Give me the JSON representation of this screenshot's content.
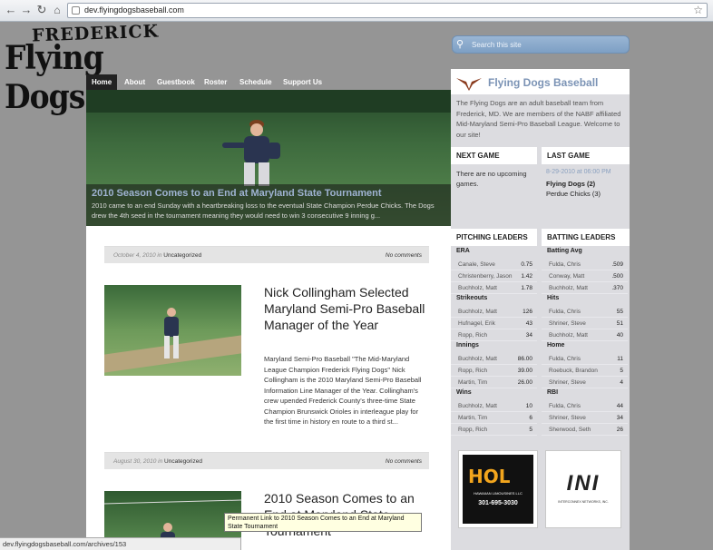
{
  "browser": {
    "url": "dev.flyingdogsbaseball.com"
  },
  "logo": {
    "line1": "FREDERICK",
    "line2": "Flying Dogs"
  },
  "nav": [
    "Home",
    "About",
    "Guestbook",
    "Roster",
    "Schedule",
    "Support Us"
  ],
  "hero": {
    "title": "2010 Season Comes to an End at Maryland State Tournament",
    "excerpt": "2010 came to an end Sunday with a heartbreaking loss to the eventual State Champion Perdue Chicks. The Dogs drew the 4th seed in the tournament meaning they would need to win 3 consecutive 9 inning g..."
  },
  "posts": [
    {
      "date": "October 4, 2010 in",
      "category": "Uncategorized",
      "comments": "No comments",
      "title": "Nick Collingham Selected Maryland Semi-Pro Baseball Manager of the Year",
      "excerpt": "Maryland Semi-Pro Baseball \"The Mid-Maryland League Champion Frederick Flying Dogs\" Nick Collingham is the 2010 Maryland Semi-Pro Baseball Information Line Manager of the Year. Collingham's crew upended Frederick County's three-time State Champion Brunswick Orioles in interleague play for the first time in history en route to a third st..."
    },
    {
      "date": "August 30, 2010 in",
      "category": "Uncategorized",
      "comments": "No comments",
      "title": "2010 Season Comes to an End at Maryland State Tournament",
      "excerpt": ""
    }
  ],
  "sidebar": {
    "search_placeholder": "Search this site",
    "title": "Flying Dogs Baseball",
    "intro": "The Flying Dogs are an adult baseball team from Frederick, MD. We are members of the NABF affiliated Mid-Maryland Semi-Pro Baseball League. Welcome to our site!",
    "next_game": {
      "heading": "NEXT GAME",
      "text": "There are no upcoming games."
    },
    "last_game": {
      "heading": "LAST GAME",
      "date": "8-29-2010 at 06:00 PM",
      "team1": "Flying Dogs (2)",
      "team2": "Perdue Chicks (3)"
    },
    "pitching": {
      "heading": "PITCHING LEADERS",
      "groups": [
        {
          "name": "ERA",
          "rows": [
            [
              "Canale, Steve",
              "0.75"
            ],
            [
              "Christenberry, Jason",
              "1.42"
            ],
            [
              "Buchholz, Matt",
              "1.78"
            ]
          ]
        },
        {
          "name": "Strikeouts",
          "rows": [
            [
              "Buchholz, Matt",
              "126"
            ],
            [
              "Hufnagel, Erik",
              "43"
            ],
            [
              "Ropp, Rich",
              "34"
            ]
          ]
        },
        {
          "name": "Innings",
          "rows": [
            [
              "Buchholz, Matt",
              "86.00"
            ],
            [
              "Ropp, Rich",
              "39.00"
            ],
            [
              "Martin, Tim",
              "26.00"
            ]
          ]
        },
        {
          "name": "Wins",
          "rows": [
            [
              "Buchholz, Matt",
              "10"
            ],
            [
              "Martin, Tim",
              "6"
            ],
            [
              "Ropp, Rich",
              "5"
            ]
          ]
        }
      ]
    },
    "batting": {
      "heading": "BATTING LEADERS",
      "groups": [
        {
          "name": "Batting Avg",
          "rows": [
            [
              "Fulda, Chris",
              ".509"
            ],
            [
              "Conway, Matt",
              ".500"
            ],
            [
              "Buchholz, Matt",
              ".370"
            ]
          ]
        },
        {
          "name": "Hits",
          "rows": [
            [
              "Fulda, Chris",
              "55"
            ],
            [
              "Shriner, Steve",
              "51"
            ],
            [
              "Buchholz, Matt",
              "40"
            ]
          ]
        },
        {
          "name": "Home",
          "rows": [
            [
              "Fulda, Chris",
              "11"
            ],
            [
              "Roebuck, Brandon",
              "5"
            ],
            [
              "Shriner, Steve",
              "4"
            ]
          ]
        },
        {
          "name": "RBI",
          "rows": [
            [
              "Fulda, Chris",
              "44"
            ],
            [
              "Shriner, Steve",
              "34"
            ],
            [
              "Sherwood, Seth",
              "26"
            ]
          ]
        }
      ]
    },
    "sponsors": [
      {
        "name": "HOL",
        "sub": "HAWAIIAN LIMOUSINES LLC",
        "phone": "301-695-3030"
      },
      {
        "name": "INI",
        "sub": "INTERCONNEX NETWORKS, INC."
      }
    ]
  },
  "tooltip": "Permanent Link to 2010 Season Comes to an End at Maryland State Tournament",
  "status": "dev.flyingdogsbaseball.com/archives/153"
}
